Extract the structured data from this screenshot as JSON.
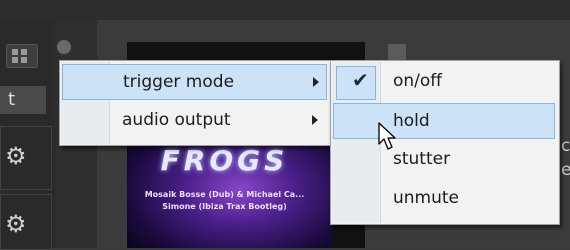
{
  "app": {
    "tab_text": "t",
    "right_edge_text_1": "c",
    "right_edge_text_2": "e"
  },
  "album": {
    "title": "FROGS",
    "line1": "Mosaik Bosse (Dub) & Michael Ca...",
    "line2": "Simone (Ibiza Trax Bootleg)"
  },
  "main_menu": {
    "items": [
      {
        "label": "trigger mode",
        "has_submenu": true,
        "highlighted": true
      },
      {
        "label": "audio output",
        "has_submenu": true,
        "highlighted": false
      }
    ]
  },
  "submenu": {
    "items": [
      {
        "label": "on/off",
        "checked": true,
        "highlighted": false
      },
      {
        "label": "hold",
        "checked": false,
        "highlighted": true
      },
      {
        "label": "stutter",
        "checked": false,
        "highlighted": false
      },
      {
        "label": "unmute",
        "checked": false,
        "highlighted": false
      }
    ],
    "check_glyph": "✔"
  },
  "colors": {
    "menu_bg": "#f2f2f2",
    "highlight": "#cce2f7",
    "highlight_border": "#87b6e2"
  }
}
